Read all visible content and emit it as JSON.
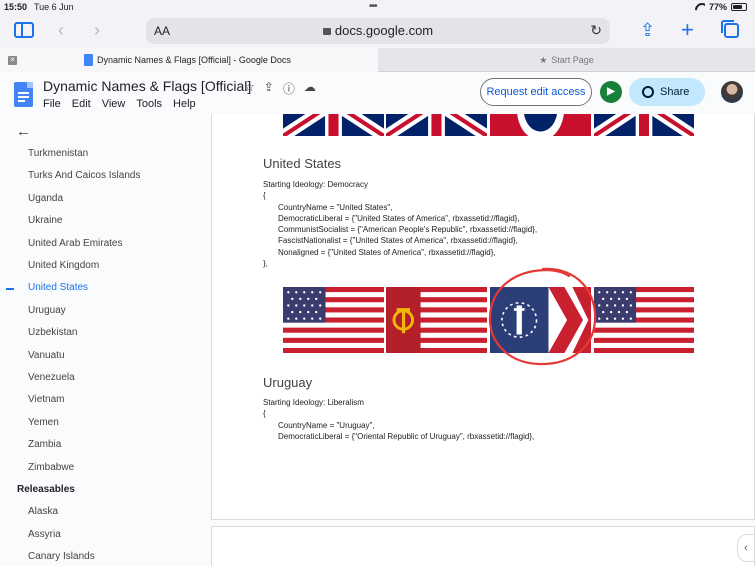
{
  "status": {
    "time": "15:50",
    "date": "Tue 6 Jun",
    "battery": "77%",
    "battery_level": 0.77
  },
  "browser": {
    "aa_label": "AA",
    "url": "docs.google.com",
    "tabs": [
      {
        "title": "Dynamic Names & Flags [Official] - Google Docs",
        "active": true
      },
      {
        "title": "Start Page",
        "active": false
      }
    ]
  },
  "docs": {
    "title": "Dynamic Names & Flags [Official]",
    "menu": [
      "File",
      "Edit",
      "View",
      "Tools",
      "Help"
    ],
    "request_edit_label": "Request edit access",
    "share_label": "Share"
  },
  "outline": {
    "items": [
      {
        "label": "Turkmenistan",
        "type": "item"
      },
      {
        "label": "Turks And Caicos Islands",
        "type": "item"
      },
      {
        "label": "Uganda",
        "type": "item"
      },
      {
        "label": "Ukraine",
        "type": "item"
      },
      {
        "label": "United Arab Emirates",
        "type": "item"
      },
      {
        "label": "United Kingdom",
        "type": "item"
      },
      {
        "label": "United States",
        "type": "current"
      },
      {
        "label": "Uruguay",
        "type": "item"
      },
      {
        "label": "Uzbekistan",
        "type": "item"
      },
      {
        "label": "Vanuatu",
        "type": "item"
      },
      {
        "label": "Venezuela",
        "type": "item"
      },
      {
        "label": "Vietnam",
        "type": "item"
      },
      {
        "label": "Yemen",
        "type": "item"
      },
      {
        "label": "Zambia",
        "type": "item"
      },
      {
        "label": "Zimbabwe",
        "type": "item"
      },
      {
        "label": "Releasables",
        "type": "header"
      },
      {
        "label": "Alaska",
        "type": "item"
      },
      {
        "label": "Assyria",
        "type": "item"
      },
      {
        "label": "Canary Islands",
        "type": "item"
      }
    ]
  },
  "document": {
    "us": {
      "heading": "United States",
      "lines": [
        {
          "text": "Starting Ideology: Democracy",
          "indent": false
        },
        {
          "text": "{",
          "indent": false
        },
        {
          "text": "CountryName = \"United States\",",
          "indent": true
        },
        {
          "text": "DemocraticLiberal = {\"United States of America\", rbxassetid://flagid},",
          "indent": true
        },
        {
          "text": "CommunistSocialist = {\"American People's Republic\", rbxassetid://flagid},",
          "indent": true
        },
        {
          "text": "FascistNationalist = {\"United States of America\", rbxassetid://flagid},",
          "indent": true
        },
        {
          "text": "Nonaligned = {\"United States of America\", rbxassetid://flagid},",
          "indent": true
        },
        {
          "text": "},",
          "indent": false
        }
      ]
    },
    "uruguay": {
      "heading": "Uruguay",
      "lines": [
        {
          "text": "Starting Ideology: Liberalism",
          "indent": false
        },
        {
          "text": "{",
          "indent": false
        },
        {
          "text": "CountryName = \"Uruguay\",",
          "indent": true
        },
        {
          "text": "DemocraticLiberal = {\"Oriental Republic of Uruguay\", rbxassetid://flagid},",
          "indent": true
        }
      ]
    }
  },
  "colors": {
    "flag_red": "#c8102e",
    "flag_blue": "#012169",
    "us_red": "#c8202f",
    "us_blue": "#3c3b6e",
    "annotation_red": "#e53935",
    "accent": "#1a73e8"
  }
}
